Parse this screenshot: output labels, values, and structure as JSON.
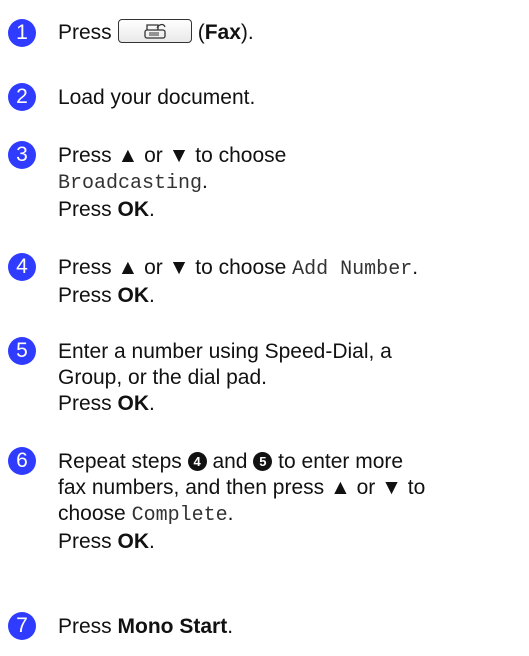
{
  "steps": [
    {
      "number": "1",
      "text_before": "Press",
      "key_open": "(",
      "key": "Fax",
      "key_close": ")."
    },
    {
      "number": "2",
      "text": "Load your document."
    },
    {
      "number": "3",
      "line1": "Press ▲ or ▼ to choose",
      "mono": "Broadcasting",
      "period": ".",
      "press": "Press",
      "ok": "OK",
      "end": "."
    },
    {
      "number": "4",
      "line1": "Press ▲ or ▼ to choose",
      "mono": "Add Number",
      "period": ".",
      "press": "Press",
      "ok": "OK",
      "end": "."
    },
    {
      "number": "5",
      "line1": "Enter a number using Speed-Dial, a",
      "line2": "Group, or the dial pad.",
      "press": "Press",
      "ok": "OK",
      "end": "."
    },
    {
      "number": "6",
      "p1": "Repeat steps",
      "ref1": "4",
      "p2": "and",
      "ref2": "5",
      "p3": "to enter more",
      "line2": "fax numbers, and then press ▲ or ▼ to",
      "choose": "choose",
      "mono": "Complete",
      "period": ".",
      "press": "Press",
      "ok": "OK",
      "end": "."
    },
    {
      "number": "7",
      "press": "Press",
      "key": "Mono Start",
      "end": "."
    }
  ],
  "icons": {
    "fax_button": "fax-machine-icon"
  },
  "colors": {
    "step_badge": "#2f3cff"
  }
}
